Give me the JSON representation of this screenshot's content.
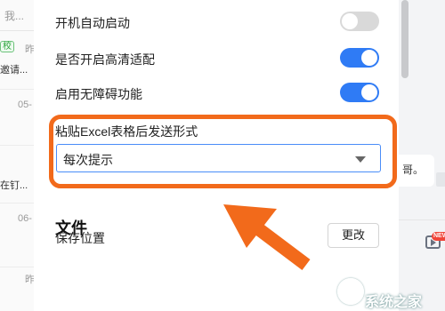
{
  "background": {
    "search_text": "我...",
    "tag_label": "校",
    "items": [
      {
        "date": "昨",
        "text": "邀请..."
      },
      {
        "date": "05-",
        "text": ""
      },
      {
        "date": "",
        "text": "在钉..."
      },
      {
        "date": "06-",
        "text": ""
      },
      {
        "date": "昨",
        "text": ""
      }
    ],
    "right_message": "哥。",
    "new_badge": "NEW"
  },
  "settings": {
    "toggles": [
      {
        "label": "开机自动启动",
        "on": false
      },
      {
        "label": "是否开启高清适配",
        "on": true
      },
      {
        "label": "启用无障碍功能",
        "on": true
      }
    ],
    "paste_label": "粘贴Excel表格后发送形式",
    "paste_value": "每次提示",
    "section_title": "文件",
    "save_label": "保存位置",
    "change_button": "更改"
  },
  "annotation": {
    "color": "#f26a1b"
  },
  "watermark": "系统之家"
}
